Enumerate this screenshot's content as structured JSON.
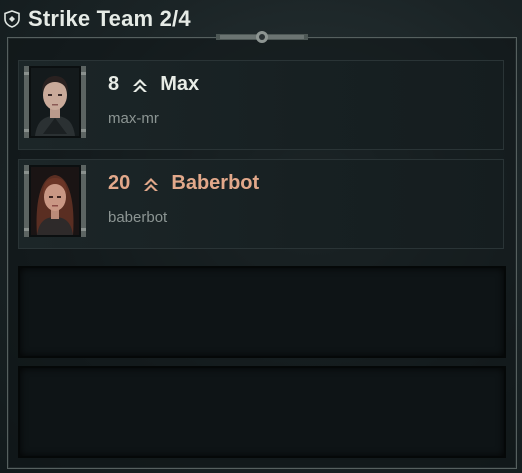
{
  "header": {
    "title": "Strike Team 2/4"
  },
  "members": [
    {
      "level": "8",
      "name": "Max",
      "handle": "max-mr",
      "rank_color": "#e8ece6"
    },
    {
      "level": "20",
      "name": "Baberbot",
      "handle": "baberbot",
      "rank_color": "#e2a88a"
    }
  ],
  "empty_slots": 2,
  "colors": {
    "accent_gold": "#e2a88a",
    "text_light": "#e8ece6",
    "handle_gray": "#8c9593"
  },
  "icons": [
    "shield-icon",
    "rank-chevron-icon"
  ]
}
